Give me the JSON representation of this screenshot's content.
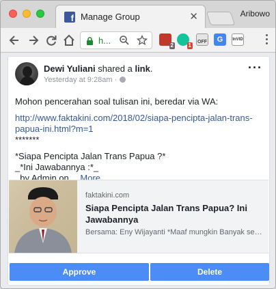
{
  "browser": {
    "tab_title": "Manage Group",
    "profile_name": "Aribowo",
    "url_display": "h..."
  },
  "extensions": [
    {
      "name": "ublock-icon",
      "badge": "2",
      "color": "#c0392b"
    },
    {
      "name": "grammarly-icon",
      "badge": "1",
      "color": "#15c39a"
    },
    {
      "name": "off-icon",
      "badge": "",
      "color": "#777777"
    },
    {
      "name": "translate-icon",
      "badge": "",
      "color": "#4285f4"
    },
    {
      "name": "invid-icon",
      "badge": "",
      "color": "#444444"
    }
  ],
  "post": {
    "author": "Dewi Yuliani",
    "action_text": " shared a ",
    "action_link": "link",
    "action_end": ".",
    "timestamp": "Yesterday at 9:28am · ",
    "intro": "Mohon pencerahan soal tulisan ini, beredar via WA:",
    "link_url": "http://www.faktakini.com/2018/02/siapa-pencipta-jalan-trans-papua-ini.html?m=1",
    "stars": "*******",
    "line1": "*Siapa Pencipta Jalan Trans Papua ?*",
    "line2": "_*Ini Jawabannya :*_",
    "line3": "_by Admin on… ",
    "more_label": "More"
  },
  "attachment": {
    "domain": "faktakini.com",
    "title": "Siapa Pencipta Jalan Trans Papua? Ini Jawabannya",
    "description": "Bersama: Eny Wijayanti *Maaf mungkin Banyak sekali yang"
  },
  "actions": {
    "approve_label": "Approve",
    "delete_label": "Delete"
  },
  "colors": {
    "accent_blue": "#4b8cf5",
    "fb_link": "#365899",
    "fb_brand": "#3b5998"
  }
}
